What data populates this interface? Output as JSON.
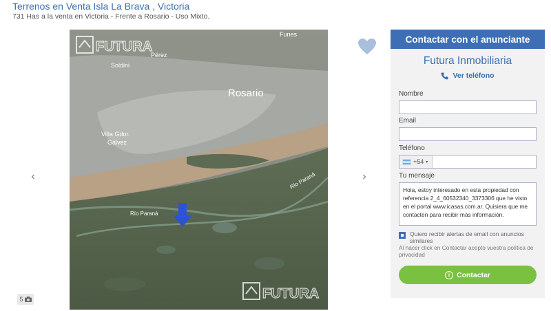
{
  "listing": {
    "title": "Terrenos en Venta Isla La Brava , Victoria",
    "subtitle": "731 Has a la venta en Victoria - Frente a Rosario - Uso Mixto."
  },
  "gallery": {
    "prev_icon": "chevron-left-icon",
    "next_icon": "chevron-right-icon",
    "photo_count": "5",
    "photo_icon": "camera-icon",
    "map_labels": {
      "funes": "Funes",
      "perez": "Pérez",
      "soldini": "Soldini",
      "rosario": "Rosario",
      "villa_gobernador_1": "Villa Gdor.",
      "villa_gobernador_2": "Gálvez",
      "rio_parana_1": "Río Paraná",
      "rio_parana_2": "Río Paraná"
    },
    "watermark_text": "FUTURA"
  },
  "favorite": {
    "icon": "heart-icon"
  },
  "contact": {
    "header": "Contactar con el anunciante",
    "agency": "Futura Inmobiliaria",
    "phone_label": "Ver teléfono",
    "name_label": "Nombre",
    "name_value": "",
    "email_label": "Email",
    "email_value": "",
    "phone_field_label": "Teléfono",
    "phone_prefix": "+54",
    "phone_value": "",
    "message_label": "Tu mensaje",
    "message_value": "Hola, estoy interesado en esta propiedad con referencia 2_4_60532340_3373306 que he visto en el portal www.icasas.com.ar. Quisiera que me contacten para recibir más información.",
    "alerts_label": "Quiero recibir alertas de email con anuncios similares",
    "alerts_checked": true,
    "legal": "Al hacer click en Contactar acepto vuestra política de privacidad",
    "submit_label": "Contactar"
  },
  "colors": {
    "brand_blue": "#3e6fb5",
    "accent_green": "#7ac142"
  }
}
